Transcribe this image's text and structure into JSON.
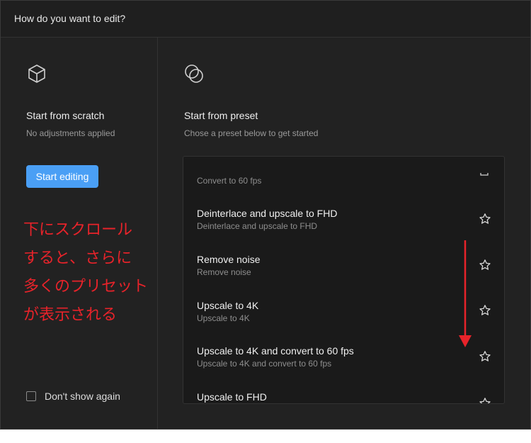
{
  "dialog": {
    "title": "How do you want to edit?"
  },
  "scratch": {
    "icon": "cube-icon",
    "title": "Start from scratch",
    "subtitle": "No adjustments applied",
    "button": "Start editing"
  },
  "preset": {
    "icon": "circles-icon",
    "title": "Start from preset",
    "subtitle": "Chose a preset below to get started",
    "items": [
      {
        "title": "",
        "subtitle": "Convert to 60 fps"
      },
      {
        "title": "Deinterlace and upscale to FHD",
        "subtitle": "Deinterlace and upscale to FHD"
      },
      {
        "title": "Remove noise",
        "subtitle": "Remove noise"
      },
      {
        "title": "Upscale to 4K",
        "subtitle": "Upscale to 4K"
      },
      {
        "title": "Upscale to 4K and convert to 60 fps",
        "subtitle": "Upscale to 4K and convert to 60 fps"
      },
      {
        "title": "Upscale to FHD",
        "subtitle": ""
      }
    ]
  },
  "annotation": {
    "lines": [
      "下にスクロール",
      "すると、さらに",
      "多くのプリセット",
      "が表示される"
    ],
    "color": "#e8232a"
  },
  "footer": {
    "dont_show_label": "Don't show again",
    "dont_show_checked": false
  },
  "colors": {
    "accent": "#4a9ff5",
    "background": "#222222"
  }
}
